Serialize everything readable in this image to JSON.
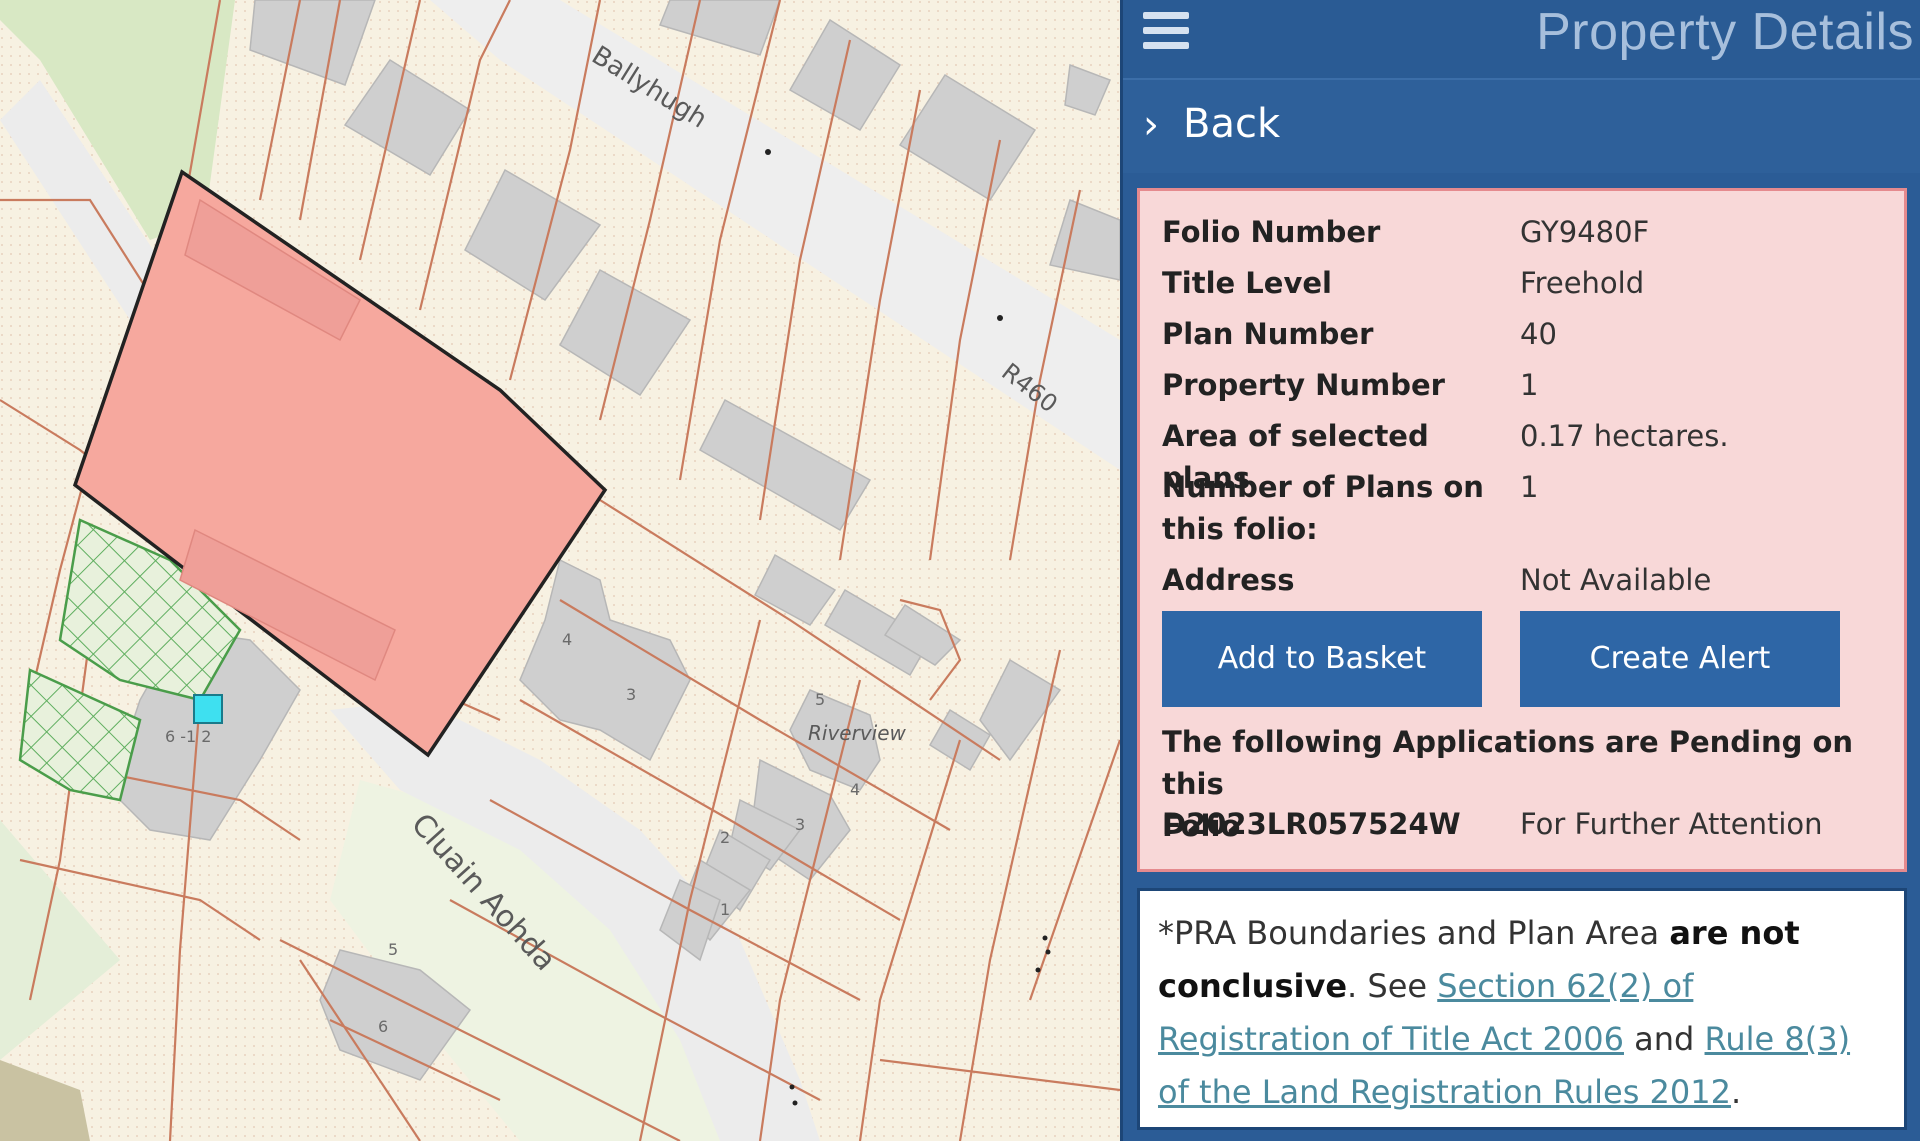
{
  "map": {
    "street_labels": {
      "ballyhugh": "Ballyhugh",
      "r460": "R460",
      "cluain_aohda": "Cluain Aohda",
      "riverview": "Riverview"
    },
    "house_numbers": [
      "4",
      "3",
      "5",
      "4",
      "3",
      "2",
      "1",
      "5",
      "6",
      "6 -1 2"
    ],
    "selected_parcel_color": "#f6a89e",
    "parcel_line_color": "#c97b5e"
  },
  "panel": {
    "title": "Property Details",
    "menu_icon": "hamburger-icon",
    "back_label": "Back",
    "details": {
      "folio_number_label": "Folio Number",
      "folio_number": "GY9480F",
      "title_level_label": "Title Level",
      "title_level": "Freehold",
      "plan_number_label": "Plan Number",
      "plan_number": "40",
      "property_number_label": "Property Number",
      "property_number": "1",
      "area_label": "Area of selected plans",
      "area": "0.17 hectares.",
      "num_plans_label_1": "Number of Plans on",
      "num_plans_label_2": "this folio:",
      "num_plans": "1",
      "address_label": "Address",
      "address": "Not Available"
    },
    "buttons": {
      "add_to_basket": "Add to Basket",
      "create_alert": "Create Alert"
    },
    "pending": {
      "heading_1": "The following Applications are Pending on this",
      "heading_2": "Folio",
      "application_id": "D2023LR057524W",
      "application_status": "For Further Attention"
    },
    "disclaimer": {
      "text_1": "*PRA Boundaries and Plan Area ",
      "bold_1": "are not",
      "bold_2": "conclusive",
      "text_2": ". See ",
      "link_1": "Section 62(2) of Registration of Title Act 2006",
      "text_3": " and ",
      "link_2": "Rule 8(3) of the Land Registration Rules 2012",
      "text_4": "."
    }
  },
  "colors": {
    "panel_bg": "#2b5c96",
    "details_bg": "#f8d8d8",
    "details_border": "#e58a8e",
    "button_bg": "#2e66a6",
    "link": "#4b8a9e"
  }
}
